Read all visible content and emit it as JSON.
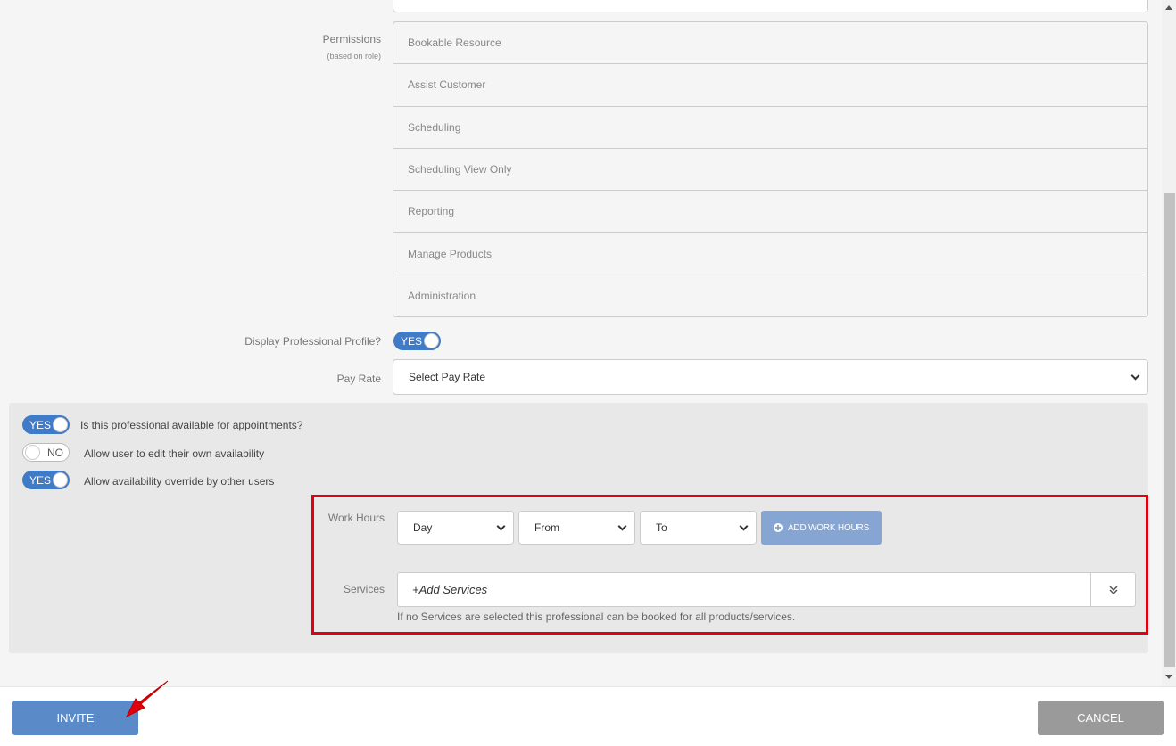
{
  "permissions": {
    "label": "Permissions",
    "sublabel": "(based on role)",
    "items": [
      "Bookable Resource",
      "Assist Customer",
      "Scheduling",
      "Scheduling View Only",
      "Reporting",
      "Manage Products",
      "Administration"
    ]
  },
  "display_profile": {
    "label": "Display Professional Profile?",
    "toggle": "YES"
  },
  "pay_rate": {
    "label": "Pay Rate",
    "selected": "Select Pay Rate"
  },
  "availability": {
    "available": {
      "toggle": "YES",
      "text": "Is this professional available for appointments?"
    },
    "edit_own": {
      "toggle": "NO",
      "text": "Allow user to edit their own availability"
    },
    "override": {
      "toggle": "YES",
      "text": "Allow availability override by other users"
    }
  },
  "work_hours": {
    "label": "Work Hours",
    "day": "Day",
    "from": "From",
    "to": "To",
    "add_button": "ADD WORK HOURS"
  },
  "services": {
    "label": "Services",
    "placeholder": "+Add Services",
    "hint": "If no Services are selected this professional can be booked for all products/services."
  },
  "footer": {
    "invite": "INVITE",
    "cancel": "CANCEL"
  },
  "colors": {
    "accent": "#3f7bc6",
    "highlight": "#e1000f",
    "invite": "#5b8ac8",
    "cancel": "#9a9a9a"
  }
}
